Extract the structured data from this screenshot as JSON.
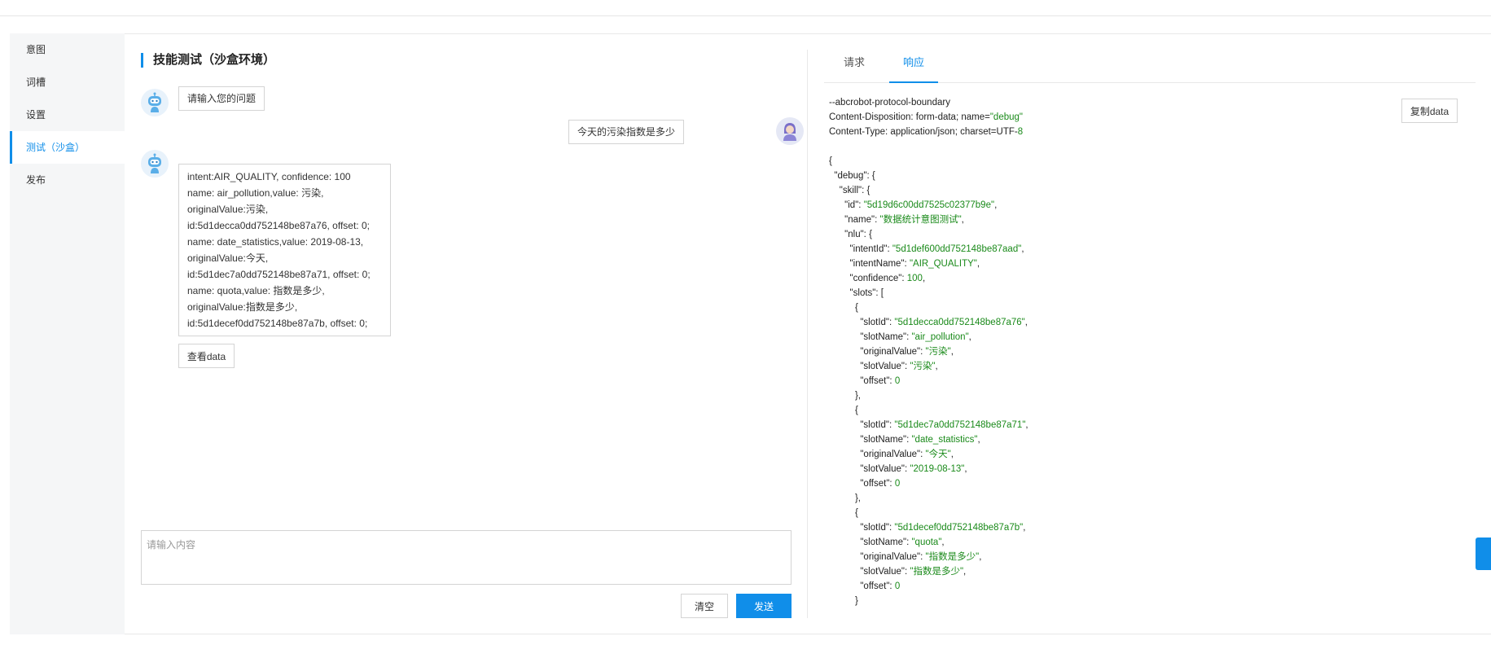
{
  "sidebar": {
    "items": [
      {
        "label": "意图"
      },
      {
        "label": "词槽"
      },
      {
        "label": "设置"
      },
      {
        "label": "测试（沙盒）",
        "active": true
      },
      {
        "label": "发布"
      }
    ]
  },
  "test": {
    "title": "技能测试（沙盒环境）",
    "bot_greeting": "请输入您的问题",
    "user_message": "今天的污染指数是多少",
    "bot_reply_lines": [
      "intent:AIR_QUALITY, confidence: 100",
      "name: air_pollution,value: 污染,",
      "originalValue:污染,",
      "id:5d1decca0dd752148be87a76, offset: 0;",
      "name: date_statistics,value: 2019-08-13,",
      "originalValue:今天,",
      "id:5d1dec7a0dd752148be87a71, offset: 0;",
      "name: quota,value: 指数是多少,",
      "originalValue:指数是多少,",
      "id:5d1decef0dd752148be87a7b, offset: 0;"
    ],
    "view_data_label": "查看data",
    "input_placeholder": "请输入内容",
    "clear_label": "清空",
    "send_label": "发送"
  },
  "response": {
    "tabs": [
      {
        "label": "请求"
      },
      {
        "label": "响应",
        "active": true
      }
    ],
    "copy_label": "复制data",
    "header_lines": {
      "boundary": "--abcrobot-protocol-boundary",
      "disposition_prefix": "Content-Disposition: form-data; name=",
      "disposition_value": "\"debug\"",
      "content_type_prefix": "Content-Type: application/json; charset=UTF-",
      "content_type_value": "8"
    },
    "json": {
      "skill_id": "\"5d19d6c00dd7525c02377b9e\"",
      "skill_name": "\"数据统计意图测试\"",
      "intent_id": "\"5d1def600dd752148be87aad\"",
      "intent_name": "\"AIR_QUALITY\"",
      "confidence": "100",
      "slots": [
        {
          "slotId": "\"5d1decca0dd752148be87a76\"",
          "slotName": "\"air_pollution\"",
          "originalValue": "\"污染\"",
          "slotValue": "\"污染\"",
          "offset": "0"
        },
        {
          "slotId": "\"5d1dec7a0dd752148be87a71\"",
          "slotName": "\"date_statistics\"",
          "originalValue": "\"今天\"",
          "slotValue": "\"2019-08-13\"",
          "offset": "0"
        },
        {
          "slotId": "\"5d1decef0dd752148be87a7b\"",
          "slotName": "\"quota\"",
          "originalValue": "\"指数是多少\"",
          "slotValue": "\"指数是多少\"",
          "offset": "0"
        }
      ]
    }
  },
  "colors": {
    "accent": "#108ee9",
    "json_value": "#1a8a1a"
  },
  "icons": {
    "bot": "robot-avatar-icon",
    "user": "user-avatar-icon",
    "float": "feedback-icon"
  }
}
